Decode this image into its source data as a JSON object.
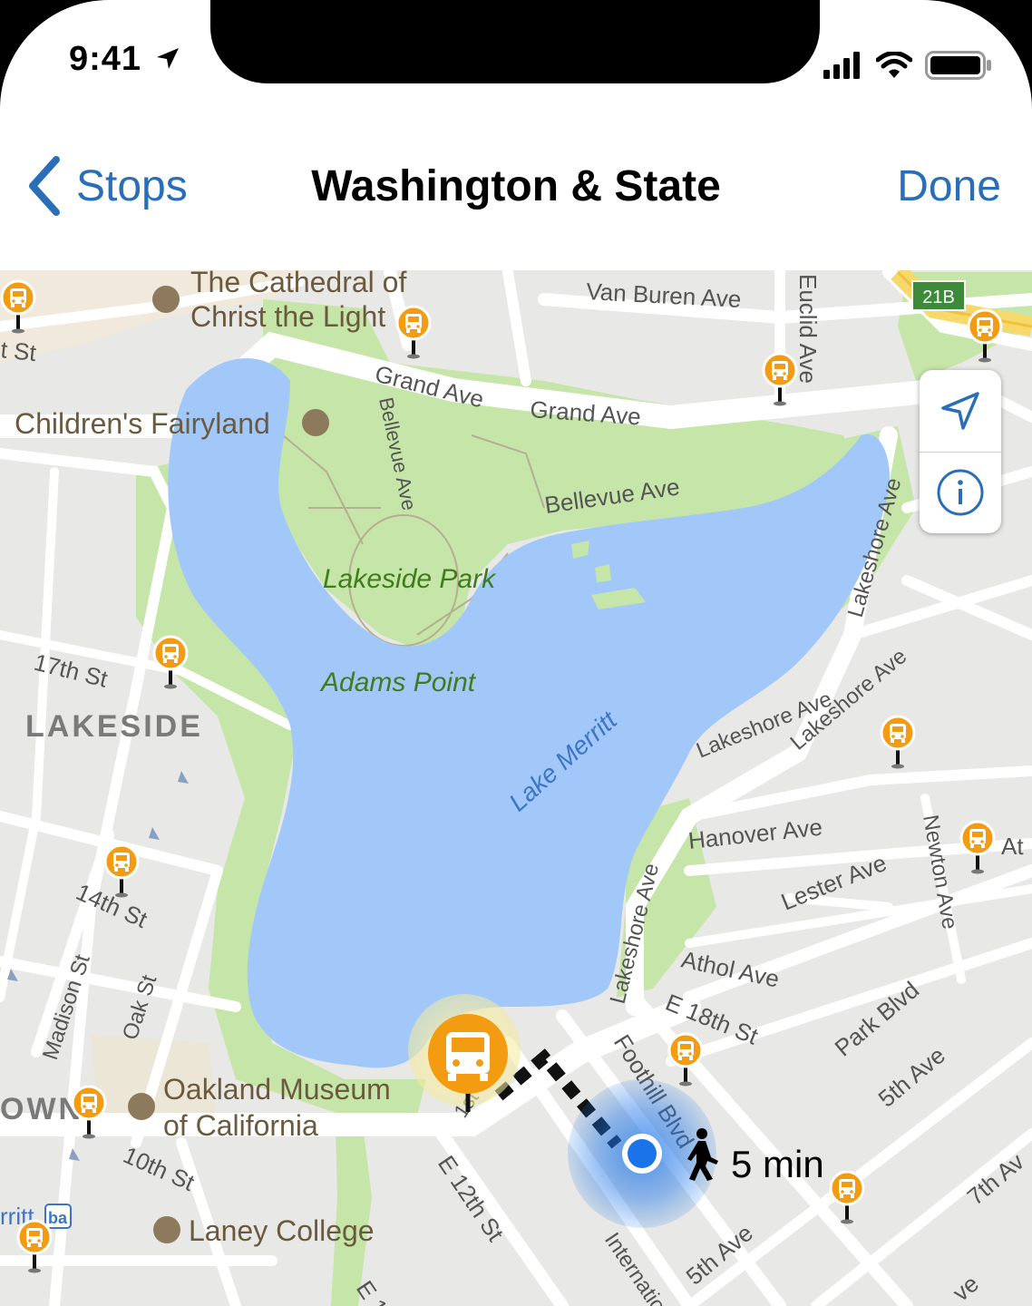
{
  "status_bar": {
    "time": "9:41"
  },
  "nav": {
    "back_label": "Stops",
    "title": "Washington & State",
    "done_label": "Done"
  },
  "map": {
    "highway_shield": "21B",
    "walk_time": "5 min",
    "labels": {
      "cathedral_line1": "The Cathedral of",
      "cathedral_line2": "Christ the Light",
      "childrens_fairyland": "Children's Fairyland",
      "grand_ave_1": "Grand Ave",
      "grand_ave_2": "Grand Ave",
      "van_buren_ave": "Van Buren Ave",
      "euclid_ave": "Euclid Ave",
      "bellevue_ave_vertical": "Bellevue Ave",
      "bellevue_ave": "Bellevue Ave",
      "lakeside_park": "Lakeside Park",
      "adams_point": "Adams Point",
      "lake_merritt": "Lake Merritt",
      "lakeshore_ave_1": "Lakeshore Ave",
      "lakeshore_ave_2": "Lakeshore Ave",
      "lakeshore_ave_3": "Lakeshore Ave",
      "lakeshore_ave_4": "Lakeshore Ave",
      "hanover_ave": "Hanover Ave",
      "lester_ave": "Lester Ave",
      "newton_ave": "Newton Ave",
      "athol_ave": "Athol Ave",
      "e_18th_st": "E 18th St",
      "park_blvd": "Park Blvd",
      "fifth_ave_1": "5th Ave",
      "fifth_ave_2": "5th Ave",
      "seventh_ave": "7th Av",
      "foothill_blvd": "Foothill Blvd",
      "first_ave": "1st",
      "e_12th_st": "E 12th St",
      "international": "International",
      "st_topleft": "t St",
      "seventeenth_st": "17th St",
      "lakeside": "LAKESIDE",
      "fourteenth_st": "14th St",
      "madison_st": "Madison St",
      "oak_st": "Oak St",
      "tenth_st": "10th St",
      "downtown_partial": "OWN",
      "museum_line1": "Oakland Museum",
      "museum_line2": "of California",
      "laney_college": "Laney College",
      "merritt_partial": "rritt",
      "bart_logo": "ba",
      "e_1x_partial": "E 1",
      "at_partial": "At",
      "ve_partial": "ve"
    }
  },
  "icons": {
    "location": "location-arrow-icon",
    "info": "info-icon",
    "bus_stop": "bus-stop-icon",
    "walk": "walking-person-icon",
    "back": "chevron-left-icon"
  },
  "colors": {
    "accent": "#2a6eb8",
    "water": "#a2c8fa",
    "park": "#c6e5a8",
    "bus_stop": "#f39c12",
    "user_location": "#1a73e8"
  }
}
